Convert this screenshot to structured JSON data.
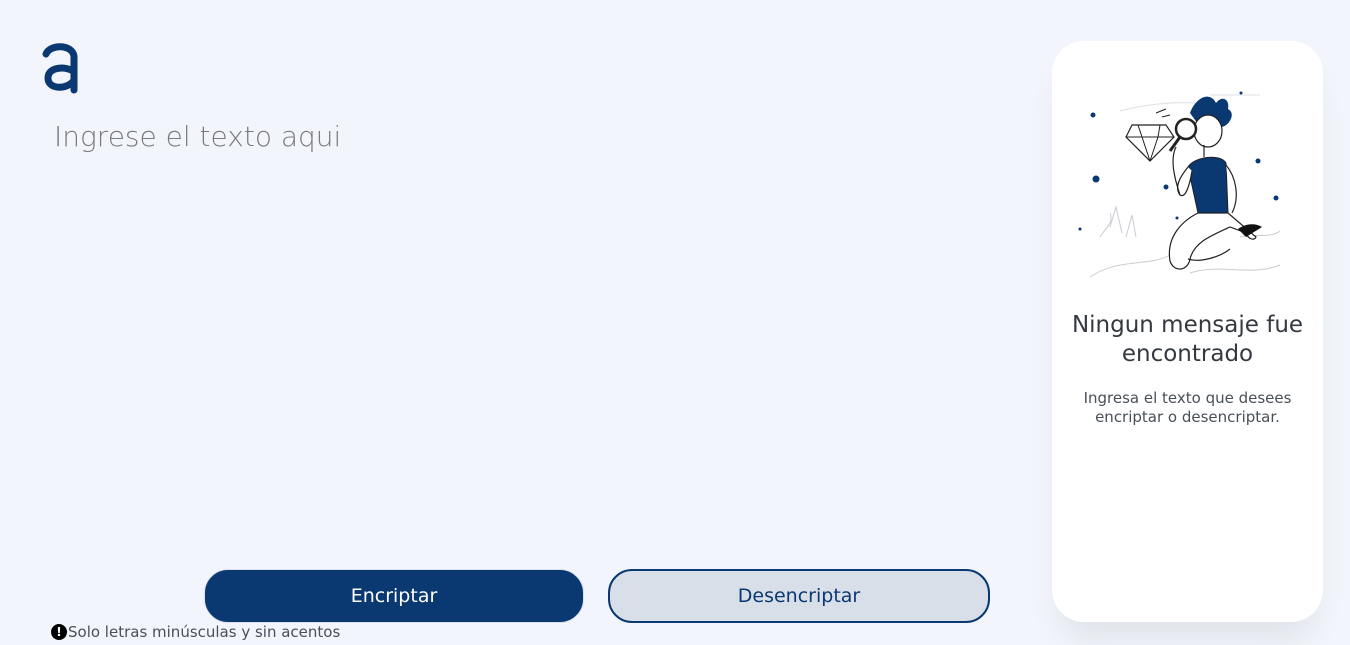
{
  "logo": {
    "letter": "a",
    "color": "#0a3871"
  },
  "input": {
    "placeholder": "Ingrese el texto aqui",
    "value": ""
  },
  "buttons": {
    "encrypt_label": "Encriptar",
    "decrypt_label": "Desencriptar"
  },
  "hint": {
    "icon": "exclamation-circle-icon",
    "text": "Solo letras minúsculas y sin acentos"
  },
  "output_panel": {
    "illustration": "person-with-magnifying-glass-illustration",
    "title": "Ningun mensaje fue encontrado",
    "message": "Ingresa el texto que desees encriptar o desencriptar."
  },
  "colors": {
    "accent": "#0a3871",
    "background": "#f3f5fc",
    "secondary_button": "#d8dfe8"
  }
}
